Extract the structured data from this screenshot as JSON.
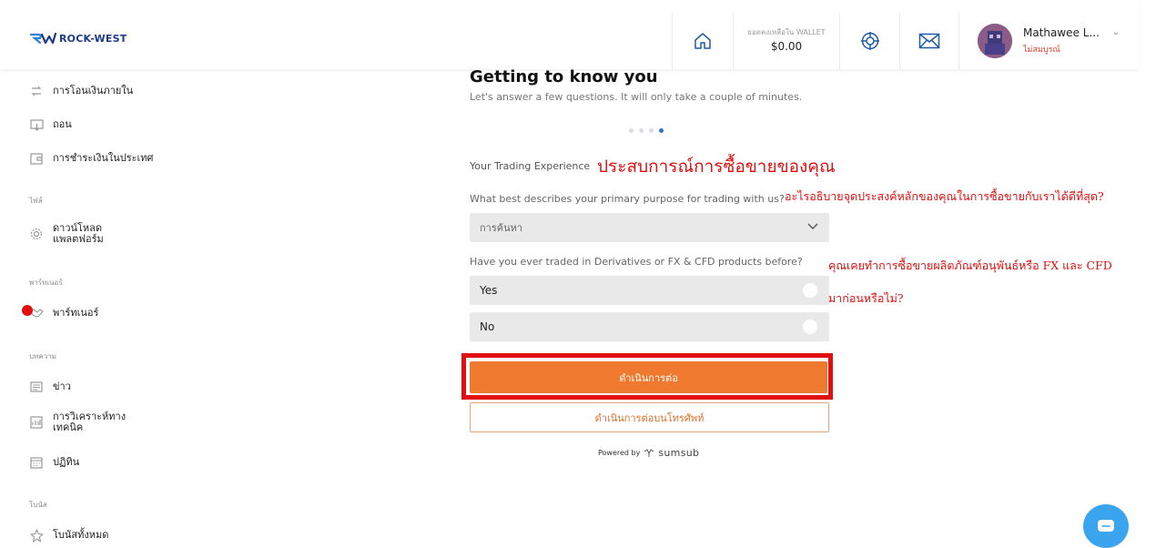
{
  "header": {
    "logo_text": "ROCK-WEST",
    "wallet_label": "ยอดคงเหลือใน WALLET",
    "wallet_value": "$0.00",
    "user_name": "Mathawee L...",
    "user_status": "ไม่สมบูรณ์"
  },
  "sidebar": {
    "items": [
      {
        "label": "การโอนเงินภายใน",
        "icon": "transfer-icon"
      },
      {
        "label": "ถอน",
        "icon": "withdraw-icon"
      },
      {
        "label": "การชำระเงินในประเทศ",
        "icon": "wallet-icon"
      },
      {
        "label": "ดาวน์โหลด\nแพลตฟอร์ม",
        "icon": "gear-icon"
      },
      {
        "label": "พาร์ทเนอร์",
        "icon": "handshake-icon"
      },
      {
        "label": "ข่าว",
        "icon": "news-icon"
      },
      {
        "label": "การวิเคราะห์ทาง\nเทคนิค",
        "icon": "chart-icon"
      },
      {
        "label": "ปฏิทิน",
        "icon": "calendar-icon"
      },
      {
        "label": "โบนัสทั้งหมด",
        "icon": "star-icon"
      }
    ],
    "sections": [
      "ไฟล์",
      "พาร์ทเนอร์",
      "บทความ",
      "โบนัส"
    ]
  },
  "main": {
    "title": "Getting to know you",
    "subtitle": "Let's answer a few questions. It will only take a couple of minutes.",
    "step_current": 4,
    "step_total": 4,
    "section_label": "Your Trading Experience",
    "question1": "What best describes your primary purpose for trading with us?",
    "select_value": "การค้นหา",
    "question2": "Have you ever traded in Derivatives or FX & CFD products before?",
    "options": [
      "Yes",
      "No"
    ],
    "continue_label": "ดำเนินการต่อ",
    "phone_label": "ดำเนินการต่อบนโทรศัพท์",
    "powered_by": "Powered by",
    "powered_brand": "sumsub"
  },
  "annotations": {
    "a1": "ประสบการณ์การซื้อขายของคุณ",
    "a2": "อะไรอธิบายจุดประสงค์หลักของคุณในการซื้อขายกับเราได้ดีที่สุด?",
    "a3_line1": "คุณเคยทำการซื้อขายผลิตภัณฑ์อนุพันธ์หรือ FX และ CFD",
    "a3_line2": "มาก่อนหรือไม่?"
  },
  "colors": {
    "accent_orange": "#ef7a2f",
    "annotation_red": "#e10f0f",
    "brand_blue": "#1d3a8a",
    "step_active": "#2f6fd6",
    "chat_blue": "#3aa5ee"
  }
}
